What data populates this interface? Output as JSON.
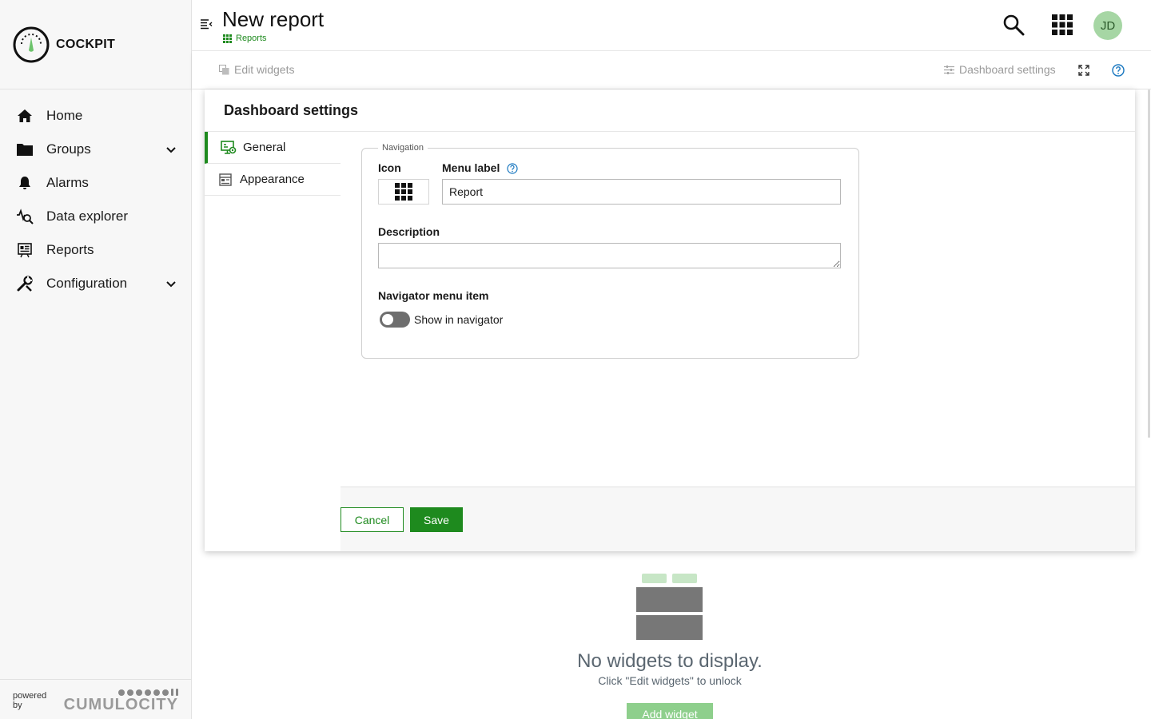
{
  "sidebar": {
    "brand": "COCKPIT",
    "items": [
      {
        "label": "Home",
        "icon": "home-icon"
      },
      {
        "label": "Groups",
        "icon": "folder-icon",
        "expandable": true
      },
      {
        "label": "Alarms",
        "icon": "bell-icon"
      },
      {
        "label": "Data explorer",
        "icon": "data-explorer-icon"
      },
      {
        "label": "Reports",
        "icon": "reports-icon"
      },
      {
        "label": "Configuration",
        "icon": "wrench-icon",
        "expandable": true
      }
    ],
    "powered_by": "powered by",
    "vendor": "CUMULOCITY"
  },
  "header": {
    "title": "New report",
    "breadcrumb": "Reports",
    "avatar_initials": "JD"
  },
  "toolbar": {
    "edit_widgets": "Edit widgets",
    "dashboard_settings": "Dashboard settings"
  },
  "panel": {
    "title": "Dashboard settings",
    "tabs": [
      {
        "label": "General",
        "active": true
      },
      {
        "label": "Appearance",
        "active": false
      }
    ],
    "navigation_legend": "Navigation",
    "icon_label": "Icon",
    "menu_label": "Menu label",
    "menu_label_value": "Report",
    "description_label": "Description",
    "description_value": "",
    "navigator_item_label": "Navigator menu item",
    "show_in_navigator": "Show in navigator",
    "show_in_navigator_on": false,
    "cancel": "Cancel",
    "save": "Save"
  },
  "empty_state": {
    "title": "No widgets to display.",
    "subtitle": "Click \"Edit widgets\" to unlock",
    "add_widget": "Add widget"
  },
  "colors": {
    "accent": "#1e8a1e",
    "accent_light": "#8ecf8c",
    "avatar_bg": "#a6d6a4",
    "help_blue": "#1776bf"
  }
}
